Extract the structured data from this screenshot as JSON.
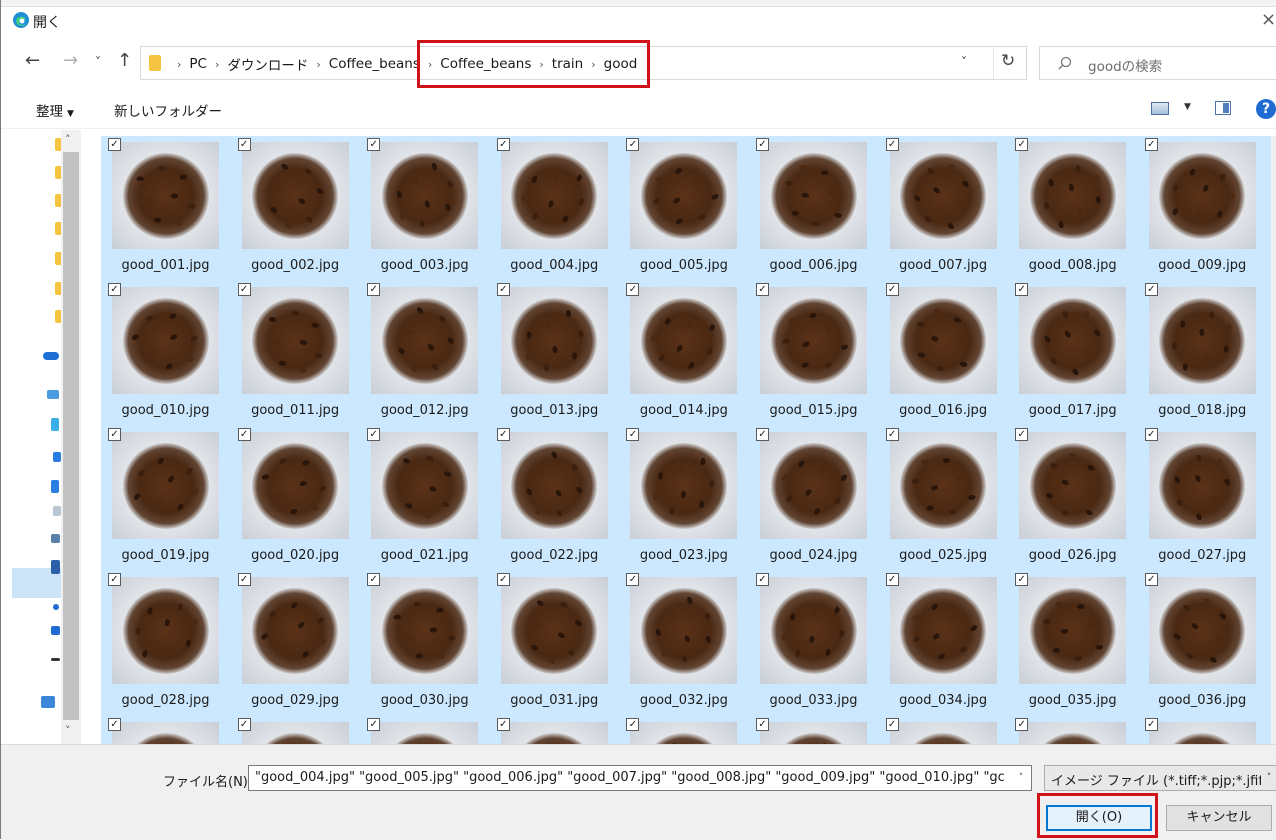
{
  "window": {
    "title": "開く",
    "close_glyph": "×"
  },
  "nav": {
    "back": "←",
    "forward": "→",
    "recent": "˅",
    "up": "↑"
  },
  "address": {
    "crumbs": [
      "PC",
      "ダウンロード",
      "Coffee_beans",
      "Coffee_beans",
      "train",
      "good"
    ],
    "separator": "›",
    "dropdown": "˅",
    "refresh": "↻"
  },
  "search": {
    "placeholder": "goodの検索"
  },
  "toolbar": {
    "organize": "整理",
    "organize_caret": "▼",
    "new_folder": "新しいフォルダー",
    "view_caret": "▼",
    "help": "?"
  },
  "files": [
    "good_001.jpg",
    "good_002.jpg",
    "good_003.jpg",
    "good_004.jpg",
    "good_005.jpg",
    "good_006.jpg",
    "good_007.jpg",
    "good_008.jpg",
    "good_009.jpg",
    "good_010.jpg",
    "good_011.jpg",
    "good_012.jpg",
    "good_013.jpg",
    "good_014.jpg",
    "good_015.jpg",
    "good_016.jpg",
    "good_017.jpg",
    "good_018.jpg",
    "good_019.jpg",
    "good_020.jpg",
    "good_021.jpg",
    "good_022.jpg",
    "good_023.jpg",
    "good_024.jpg",
    "good_025.jpg",
    "good_026.jpg",
    "good_027.jpg",
    "good_028.jpg",
    "good_029.jpg",
    "good_030.jpg",
    "good_031.jpg",
    "good_032.jpg",
    "good_033.jpg",
    "good_034.jpg",
    "good_035.jpg",
    "good_036.jpg",
    "",
    "",
    "",
    "",
    "",
    "",
    "",
    "",
    ""
  ],
  "checkbox_glyph": "✓",
  "bottom": {
    "filename_label": "ファイル名(N):",
    "filename_value": "\"good_004.jpg\" \"good_005.jpg\" \"good_006.jpg\" \"good_007.jpg\" \"good_008.jpg\" \"good_009.jpg\" \"good_010.jpg\" \"gc",
    "filetype_value": "イメージ ファイル (*.tiff;*.pjp;*.jfif;*.",
    "dropdown": "˅",
    "open_button": "開く(O)",
    "cancel_button": "キャンセル"
  },
  "colors": {
    "selection": "#cce8ff",
    "highlight": "#d0121b",
    "accent": "#0078d4"
  }
}
